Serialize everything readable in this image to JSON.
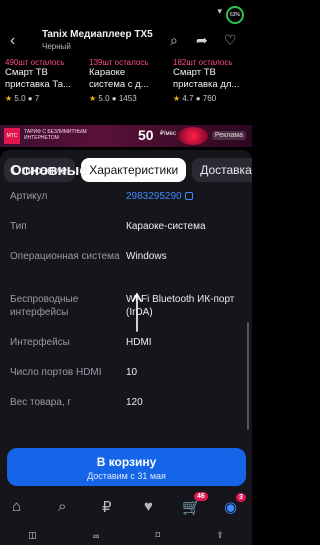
{
  "status": {
    "battery": "63%"
  },
  "header": {
    "title": "Tanix Медиаплеер TX5",
    "subtitle": "Черный"
  },
  "recs": [
    {
      "stock": "490шт осталось",
      "name": "Смарт ТВ",
      "name2": "приставка Та...",
      "rating": "5.0",
      "reviews": "7"
    },
    {
      "stock": "139шт осталось",
      "name": "Караоке",
      "name2": "система с д...",
      "rating": "5.0",
      "reviews": "1453"
    },
    {
      "stock": "182шт осталось",
      "name": "Смарт ТВ",
      "name2": "приставка дл...",
      "rating": "4.7",
      "reviews": "760"
    }
  ],
  "banner": {
    "tag": "МТС",
    "text": "ТАРИФ С БЕЗЛИМИТНЫМ ИНТЕРНЕТОМ",
    "price": "50",
    "price_unit": "₽/мес",
    "ad": "Реклама"
  },
  "tabs": [
    {
      "label": "Описание",
      "active": false
    },
    {
      "label": "Характеристики",
      "active": true
    },
    {
      "label": "Доставка",
      "active": false
    }
  ],
  "section_title": "Основные",
  "specs": [
    {
      "label": "Артикул",
      "value": "2983295290",
      "link": true
    },
    {
      "label": "Тип",
      "value": "Караоке-система"
    },
    {
      "label": "Операционная система",
      "value": "Windows"
    },
    {
      "label": "Беспроводные интерфейсы",
      "value": "Wi-Fi Bluetooth ИК-порт (IrDA)"
    },
    {
      "label": "Интерфейсы",
      "value": "HDMI"
    },
    {
      "label": "Число портов HDMI",
      "value": "10"
    },
    {
      "label": "Вес товара, г",
      "value": "120"
    }
  ],
  "cart": {
    "label": "В корзину",
    "delivery": "Доставим с 31 мая"
  },
  "nav": {
    "cart_badge": "46",
    "profile_badge": "3"
  }
}
